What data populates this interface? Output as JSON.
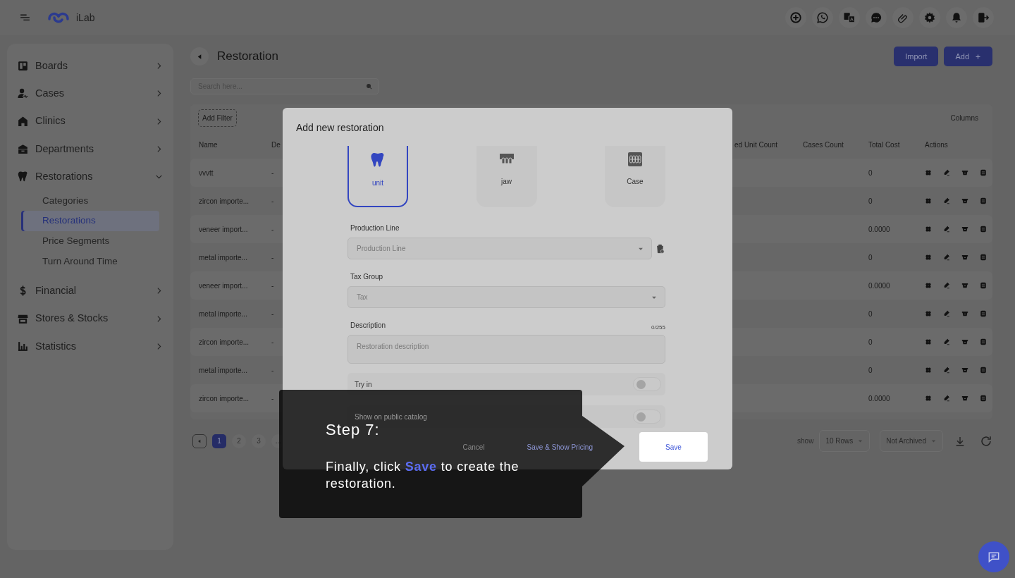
{
  "header": {
    "app_name": "iLab"
  },
  "sidebar": {
    "items": [
      {
        "label": "Boards",
        "expanded": false
      },
      {
        "label": "Cases",
        "expanded": false
      },
      {
        "label": "Clinics",
        "expanded": false
      },
      {
        "label": "Departments",
        "expanded": false
      },
      {
        "label": "Restorations",
        "expanded": true,
        "children": [
          {
            "label": "Categories",
            "selected": false
          },
          {
            "label": "Restorations",
            "selected": true
          },
          {
            "label": "Price Segments",
            "selected": false
          },
          {
            "label": "Turn Around Time",
            "selected": false
          }
        ]
      },
      {
        "label": "Financial",
        "expanded": false
      },
      {
        "label": "Stores & Stocks",
        "expanded": false
      },
      {
        "label": "Statistics",
        "expanded": false
      }
    ]
  },
  "page": {
    "title": "Restoration",
    "buttons": [
      "Import",
      "Add"
    ],
    "search": {
      "placeholder": "Search here..."
    }
  },
  "table": {
    "filter_button": "Add Filter",
    "columns_button": "Columns",
    "columns": [
      "Name",
      "De",
      "ed Unit Count",
      "Cases Count",
      "Total Cost",
      "Actions"
    ],
    "rows": [
      {
        "name": "vvvtt",
        "description": "-",
        "total_cost": "0"
      },
      {
        "name": "zircon importe...",
        "description": "-",
        "total_cost": "0"
      },
      {
        "name": "veneer import...",
        "description": "-",
        "total_cost": "0.0000"
      },
      {
        "name": "metal importe...",
        "description": "-",
        "total_cost": "0"
      },
      {
        "name": "veneer import...",
        "description": "-",
        "total_cost": "0.0000"
      },
      {
        "name": "metal importe...",
        "description": "-",
        "total_cost": "0"
      },
      {
        "name": "zircon importe...",
        "description": "-",
        "total_cost": "0"
      },
      {
        "name": "metal importe...",
        "description": "-",
        "total_cost": "0"
      },
      {
        "name": "zircon importe...",
        "description": "-",
        "total_cost": "0.0000"
      }
    ]
  },
  "pagination": {
    "pages": [
      {
        "label": "1",
        "selected": true
      },
      {
        "label": "2",
        "selected": false
      },
      {
        "label": "3",
        "selected": false
      },
      {
        "label": "...",
        "selected": false
      }
    ],
    "show_label": "show",
    "rows_select": "10 Rows",
    "archive_select": "Not Archived"
  },
  "modal": {
    "title": "Add new restoration",
    "types": [
      {
        "label": "unit",
        "selected": true
      },
      {
        "label": "jaw",
        "selected": false
      },
      {
        "label": "Case",
        "selected": false
      }
    ],
    "fields": [
      {
        "label": "Production Line",
        "kind": "select",
        "placeholder": "Production Line",
        "removable": true
      },
      {
        "label": "Tax Group",
        "kind": "select",
        "placeholder": "Tax",
        "removable": false
      },
      {
        "label": "Description",
        "kind": "textarea",
        "placeholder": "Restoration description",
        "counter": "0/255"
      }
    ],
    "toggles": [
      {
        "label": "Try in",
        "on": false
      },
      {
        "label": "Show on public catalog",
        "on": false
      }
    ],
    "footer": {
      "cancel": "Cancel",
      "secondary": "Save & Show Pricing",
      "primary": "Save"
    }
  },
  "tour": {
    "title": "Step 7:",
    "text": "Finally, click **Save** to create the restoration."
  }
}
